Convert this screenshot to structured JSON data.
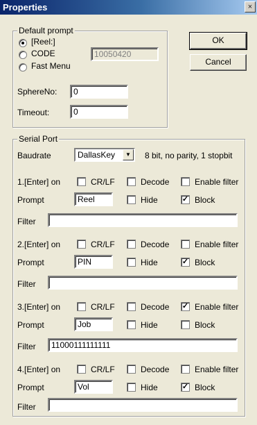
{
  "window": {
    "title": "Properties",
    "close_glyph": "×"
  },
  "default_prompt": {
    "legend": "Default prompt",
    "options": [
      {
        "label": "[Reel:]",
        "selected": true
      },
      {
        "label": "CODE",
        "selected": false
      },
      {
        "label": "Fast Menu",
        "selected": false
      }
    ],
    "code_value": "10050420",
    "sphereno_label": "SphereNo:",
    "sphereno_value": "0",
    "timeout_label": "Timeout:",
    "timeout_value": "0"
  },
  "buttons": {
    "ok": "OK",
    "cancel": "Cancel"
  },
  "serial_port": {
    "legend": "Serial Port",
    "baudrate_label": "Baudrate",
    "baudrate_value": "DallasKey",
    "baudrate_info": "8 bit, no parity, 1 stopbit",
    "entries": [
      {
        "enter_label": "1.[Enter] on",
        "crlf": false,
        "decode": false,
        "enable_filter": false,
        "prompt_label": "Prompt",
        "prompt_value": "Reel",
        "hide": false,
        "block": true,
        "filter_label": "Filter",
        "filter_value": ""
      },
      {
        "enter_label": "2.[Enter] on",
        "crlf": false,
        "decode": false,
        "enable_filter": false,
        "prompt_label": "Prompt",
        "prompt_value": "PIN",
        "hide": false,
        "block": true,
        "filter_label": "Filter",
        "filter_value": ""
      },
      {
        "enter_label": "3.[Enter] on",
        "crlf": false,
        "decode": false,
        "enable_filter": true,
        "prompt_label": "Prompt",
        "prompt_value": "Job",
        "hide": false,
        "block": false,
        "filter_label": "Filter",
        "filter_value": "11000111111111"
      },
      {
        "enter_label": "4.[Enter] on",
        "crlf": false,
        "decode": false,
        "enable_filter": false,
        "prompt_label": "Prompt",
        "prompt_value": "Vol",
        "hide": false,
        "block": true,
        "filter_label": "Filter",
        "filter_value": ""
      }
    ],
    "labels": {
      "crlf": "CR/LF",
      "decode": "Decode",
      "enable_filter": "Enable filter",
      "hide": "Hide",
      "block": "Block"
    }
  },
  "icons": {
    "check_mark": "✓",
    "dropdown": "▼"
  }
}
